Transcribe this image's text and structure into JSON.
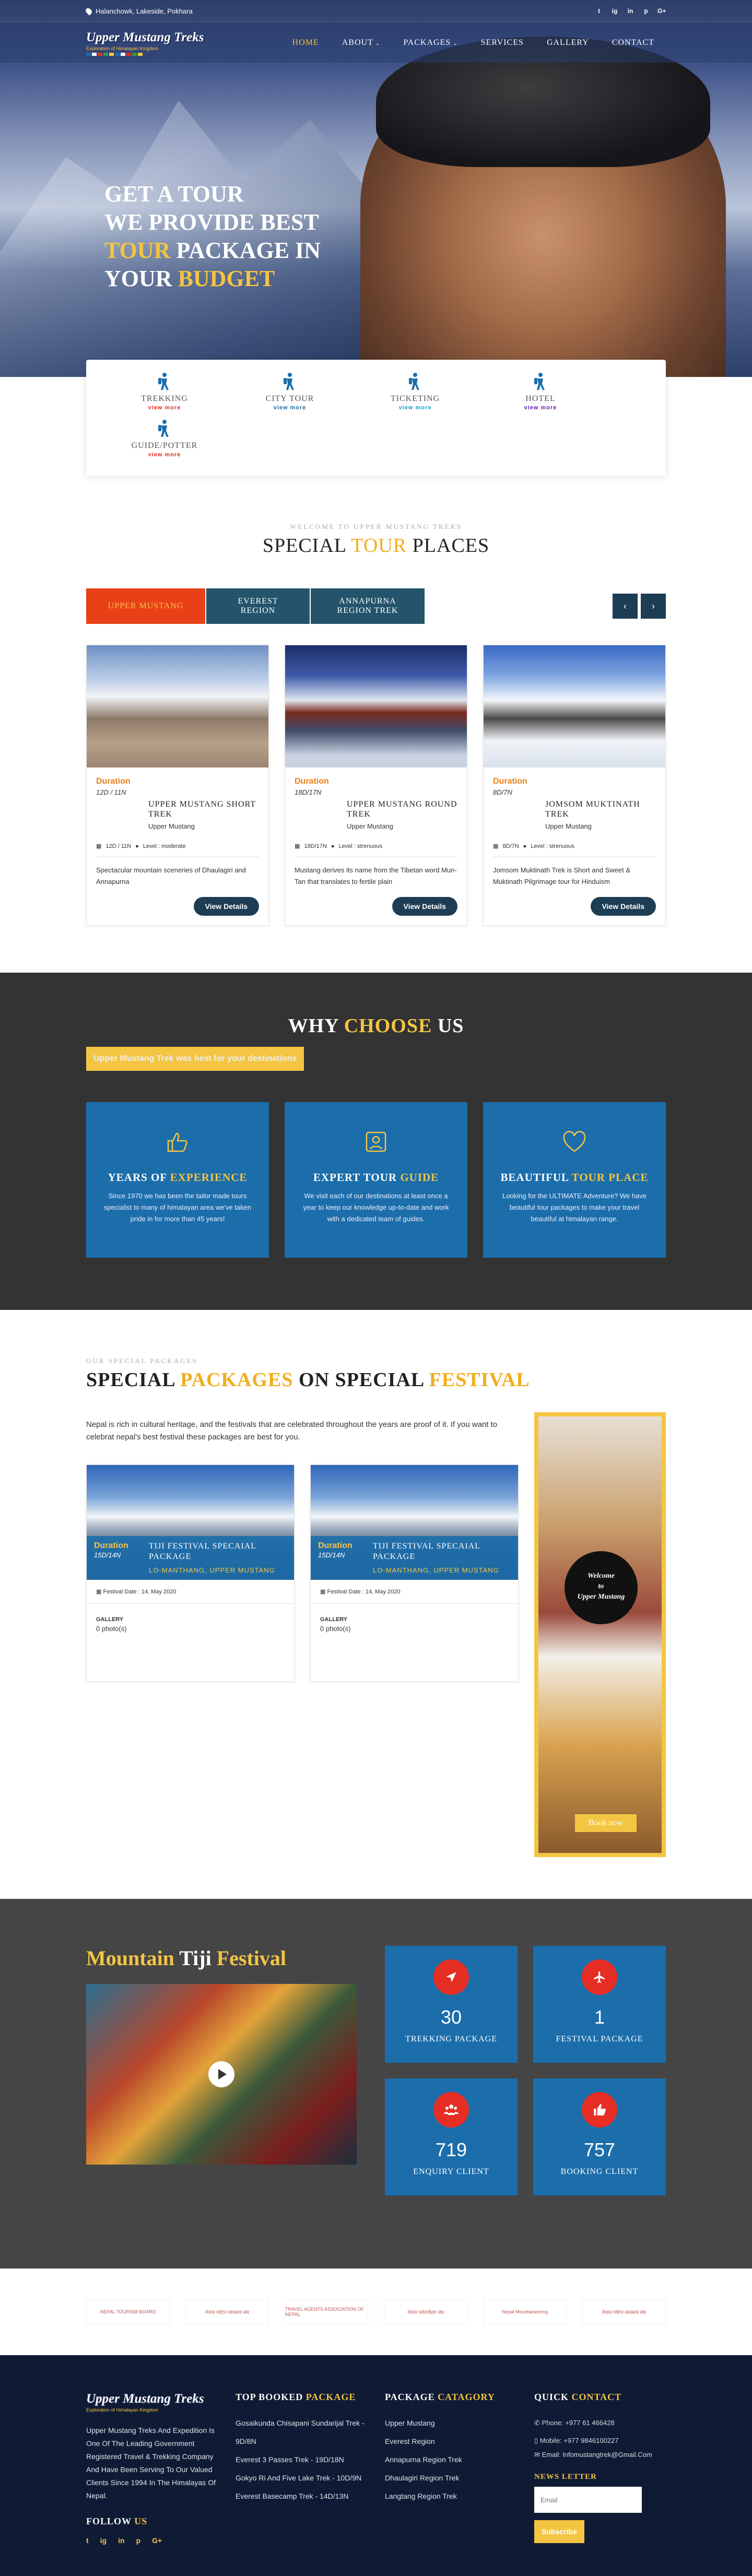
{
  "topbar": {
    "address": "Halanchowk, Lakeside, Pokhara",
    "social": [
      "t",
      "ig",
      "in",
      "p",
      "G+"
    ]
  },
  "brand": {
    "name": "Upper Mustang Treks",
    "tagline": "Exploration of Himalayan Kingdom"
  },
  "nav": {
    "items": [
      "HOME",
      "ABOUT",
      "PACKAGES",
      "SERVICES",
      "GALLERY",
      "CONTACT"
    ]
  },
  "hero": {
    "line1": "GET A TOUR",
    "line2": "WE PROVIDE BEST",
    "line3a": "TOUR",
    "line3b": " PACKAGE IN",
    "line4a": "YOUR ",
    "line4b": "BUDGET"
  },
  "services": [
    {
      "label": "TREKKING",
      "more": "view more",
      "color": "#e62e25"
    },
    {
      "label": "CITY TOUR",
      "more": "view more",
      "color": "#1c6eab"
    },
    {
      "label": "TICKETING",
      "more": "view more",
      "color": "#18a0c9"
    },
    {
      "label": "HOTEL",
      "more": "view more",
      "color": "#6a1fb5"
    },
    {
      "label": "GUIDE/POTTER",
      "more": "view more",
      "color": "#e62e25"
    }
  ],
  "places": {
    "tag": "WELCOME TO UPPER MUSTANG TREKS",
    "title_a": "SPECIAL ",
    "title_b": "TOUR",
    "title_c": " PLACES",
    "tabs": [
      "UPPER MUSTANG",
      "EVEREST REGION",
      "ANNAPURNA REGION TREK"
    ],
    "prev": "‹",
    "next": "›",
    "cards": [
      {
        "dur_label": "Duration",
        "dur": "12D / 11N",
        "title": "UPPER MUSTANG SHORT TREK",
        "sub": "Upper Mustang",
        "meta_dur": "12D / 11N",
        "level": "Level : moderate",
        "desc": "Spectacular mountain sceneries of Dhaulagiri and Annapurna",
        "btn": "View Details"
      },
      {
        "dur_label": "Duration",
        "dur": "18D/17N",
        "title": "UPPER MUSTANG ROUND TREK",
        "sub": "Upper Mustang",
        "meta_dur": "18D/17N",
        "level": "Level : strenuous",
        "desc": "Mustang derives its name from the Tibetan word Mun-Tan that translates to fertile plain",
        "btn": "View Details"
      },
      {
        "dur_label": "Duration",
        "dur": "8D/7N",
        "title": "JOMSOM MUKTINATH TREK",
        "sub": "Upper Mustang",
        "meta_dur": "8D/7N",
        "level": "Level : strenuous",
        "desc": "Jomsom Muktinath Trek is Short and Sweet & Muktinath Pilgrimage tour for Hinduism",
        "btn": "View Details"
      }
    ]
  },
  "why": {
    "title_a": "WHY ",
    "title_b": "CHOOSE",
    "title_c": " US",
    "sub": "Upper Mustang Trek was best for your destinations",
    "cards": [
      {
        "t1": "YEARS OF ",
        "t2": "EXPERIENCE",
        "text": "Since 1970 we has been the tailor made tours specialist to many of himalayan area we've taken pride in for more than 45 years!"
      },
      {
        "t1": "EXPERT TOUR ",
        "t2": "GUIDE",
        "text": "We visit each of our destinations at least once a year to keep our knowledge up-to-date and work with a dedicated team of guides."
      },
      {
        "t1": "BEAUTIFUL ",
        "t2": "TOUR PLACE",
        "text": "Looking for the ULTIMATE Adventure? We have beautiful tour packages to make your travel beautiful at himalayan range."
      }
    ]
  },
  "special": {
    "tag": "OUR SPECIAL PACKAGES",
    "t1": "SPECIAL ",
    "t2": "PACKAGES",
    "t3": " ON SPECIAL ",
    "t4": "FESTIVAL",
    "intro": "Nepal is rich in cultural heritage, and the festivals that are celebrated throughout the years are proof of it. If you want to celebrat nepal's best festival these packages are best for you.",
    "cards": [
      {
        "dur_label": "Duration",
        "dur": "15D/14N",
        "title": "TIJI FESTIVAL SPECAIAL PACKAGE",
        "loc": "LO-MANTHANG, UPPER MUSTANG",
        "date": "Festival Date : 14, May 2020",
        "gal": "GALLERY",
        "photos": "0 photo(s)"
      },
      {
        "dur_label": "Duration",
        "dur": "15D/14N",
        "title": "TIJI FESTIVAL SPECAIAL PACKAGE",
        "loc": "LO-MANTHANG, UPPER MUSTANG",
        "date": "Festival Date : 14, May 2020",
        "gal": "GALLERY",
        "photos": "0 photo(s)"
      }
    ],
    "poster": {
      "l1": "Welcome",
      "l2": "to",
      "l3": "Upper Mustang",
      "book": "Book now"
    }
  },
  "tiji": {
    "t1": "Mountain ",
    "t2": "Tiji",
    "t3": " Festival",
    "stats": [
      {
        "num": "30",
        "label": "TREKKING PACKAGE",
        "icon": "navigation-icon"
      },
      {
        "num": "1",
        "label": "FESTIVAL PACKAGE",
        "icon": "plane-icon"
      },
      {
        "num": "719",
        "label": "ENQUIRY CLIENT",
        "icon": "group-icon"
      },
      {
        "num": "757",
        "label": "BOOKING CLIENT",
        "icon": "thumbs-up-icon"
      }
    ]
  },
  "partners": [
    "NEPAL TOURISM BOARD",
    "नेपाल पर्यटन व्यवसाय संघ",
    "TRAVEL AGENTS ASSOCIATION OF NEPAL",
    "नेपाल पर्वतारोहण संघ",
    "Nepal Mountaineering",
    "नेपाल पर्यटन व्यवसाय संघ"
  ],
  "footer": {
    "about": "Upper Mustang Treks And Expedition Is One Of The Leading Government Registered Travel & Trekking Company And Have Been Serving To Our Valued Clients Since 1994 In The Himalayas Of Nepal.",
    "follow_a": "FOLLOW ",
    "follow_b": "US",
    "top_a": "TOP BOOKED ",
    "top_b": "PACKAGE",
    "top": [
      "Gosaikunda Chisapani Sundarijal Trek - 9D/8N",
      "Everest 3 Passes Trek - 19D/18N",
      "Gokyo Ri And Five Lake Trek - 10D/9N",
      "Everest Basecamp Trek - 14D/13N"
    ],
    "cat_a": "PACKAGE ",
    "cat_b": "CATAGORY",
    "cats": [
      "Upper Mustang",
      "Everest Region",
      "Annapurna Region Trek",
      "Dhaulagiri Region Trek",
      "Langtang Region Trek"
    ],
    "qc_a": "QUICK ",
    "qc_b": "CONTACT",
    "phone": "Phone: +977 61 466428",
    "mobile": "Mobile: +977 9846100227",
    "email": "Email: Infomustangtrek@Gmail.Com",
    "news": "NEWS LETTER",
    "email_ph": "Email",
    "subscribe": "Subscribe"
  }
}
